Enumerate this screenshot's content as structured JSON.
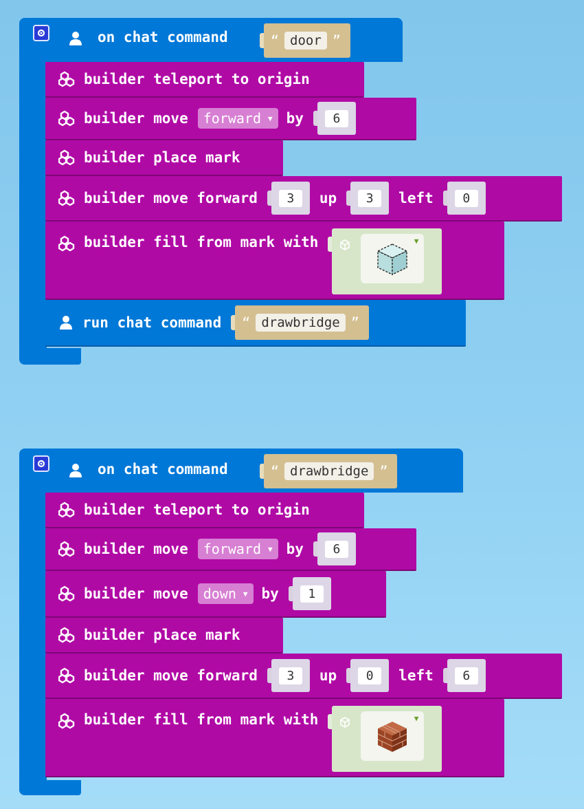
{
  "group1": {
    "header": {
      "keyword": "on chat command",
      "string_value": "door"
    },
    "rows": [
      {
        "keyword": "builder teleport to origin"
      },
      {
        "keyword": "builder move",
        "direction": "forward",
        "by_label": "by",
        "amount": "6"
      },
      {
        "keyword": "builder place mark"
      },
      {
        "keyword": "builder move forward",
        "v1": "3",
        "up_label": "up",
        "v2": "3",
        "left_label": "left",
        "v3": "0"
      },
      {
        "keyword": "builder fill from mark with",
        "block": "glass-block-icon"
      }
    ],
    "run": {
      "keyword": "run chat command",
      "string_value": "drawbridge"
    }
  },
  "group2": {
    "header": {
      "keyword": "on chat command",
      "string_value": "drawbridge"
    },
    "rows": [
      {
        "keyword": "builder teleport to origin"
      },
      {
        "keyword": "builder move",
        "direction": "forward",
        "by_label": "by",
        "amount": "6"
      },
      {
        "keyword": "builder move",
        "direction": "down",
        "by_label": "by",
        "amount": "1"
      },
      {
        "keyword": "builder place mark"
      },
      {
        "keyword": "builder move forward",
        "v1": "3",
        "up_label": "up",
        "v2": "0",
        "left_label": "left",
        "v3": "6"
      },
      {
        "keyword": "builder fill from mark with",
        "block": "brick-block-icon"
      }
    ]
  },
  "colors": {
    "event_blue": "#0078d7",
    "builder_purple": "#b00aa5",
    "string_tan": "#d4bf91",
    "block_green": "#d7e6c9"
  }
}
